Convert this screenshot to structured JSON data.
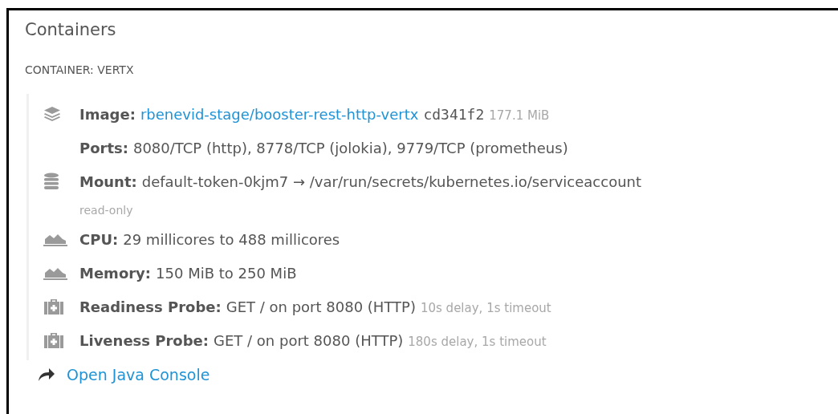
{
  "title": "Containers",
  "container": {
    "heading": "CONTAINER: VERTX",
    "items": [
      {
        "kind": "image",
        "label": "Image:",
        "parts": [
          {
            "kind": "link",
            "text": "rbenevid-stage/booster-rest-http-vertx"
          },
          {
            "kind": "mono",
            "text": "cd341f2"
          },
          {
            "kind": "muted",
            "text": "177.1 MiB"
          }
        ]
      },
      {
        "kind": "ports",
        "label": "Ports:",
        "parts": [
          {
            "kind": "plain",
            "text": "8080/TCP (http), 8778/TCP (jolokia), 9779/TCP (prometheus)"
          }
        ]
      },
      {
        "kind": "mount",
        "label": "Mount:",
        "parts": [
          {
            "kind": "plain",
            "text": "default-token-0kjm7 → /var/run/secrets/kubernetes.io/serviceaccount"
          }
        ],
        "note": "read-only"
      },
      {
        "kind": "resource",
        "label": "CPU:",
        "parts": [
          {
            "kind": "plain",
            "text": "29 millicores to 488 millicores"
          }
        ]
      },
      {
        "kind": "resource",
        "label": "Memory:",
        "parts": [
          {
            "kind": "plain",
            "text": "150 MiB to 250 MiB"
          }
        ]
      },
      {
        "kind": "probe",
        "label": "Readiness Probe:",
        "parts": [
          {
            "kind": "plain",
            "text": "GET / on port 8080 (HTTP)"
          },
          {
            "kind": "muted",
            "text": "10s delay, 1s timeout"
          }
        ]
      },
      {
        "kind": "probe",
        "label": "Liveness Probe:",
        "parts": [
          {
            "kind": "plain",
            "text": "GET / on port 8080 (HTTP)"
          },
          {
            "kind": "muted",
            "text": "180s delay, 1s timeout"
          }
        ]
      }
    ]
  },
  "link": {
    "text": "Open Java Console"
  }
}
